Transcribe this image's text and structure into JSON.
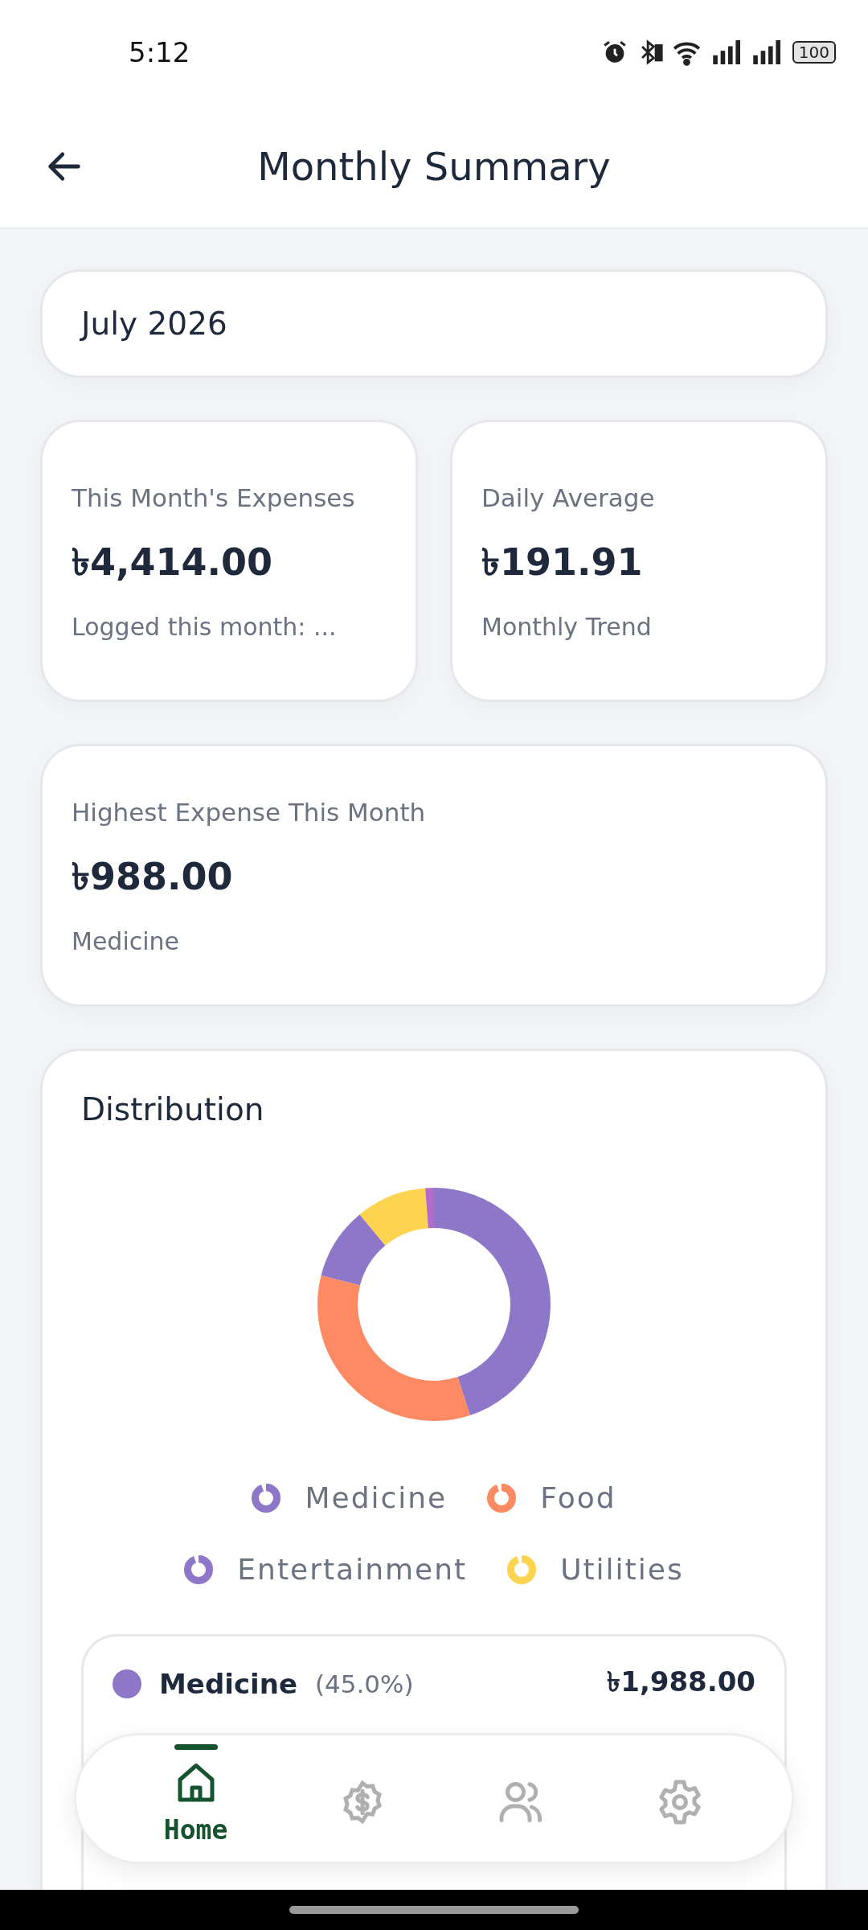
{
  "status_bar": {
    "time": "5:12",
    "battery": "100"
  },
  "header": {
    "title": "Monthly Summary"
  },
  "month": {
    "value": "July 2026"
  },
  "stats": [
    {
      "label": "This Month's Expenses",
      "value": "৳4,414.00",
      "note": "Logged this month: ..."
    },
    {
      "label": "Daily Average",
      "value": "৳191.91",
      "note": "Monthly Trend"
    }
  ],
  "highest": {
    "label": "Highest Expense This Month",
    "value": "৳988.00",
    "note": "Medicine"
  },
  "distribution": {
    "title": "Distribution",
    "legend": [
      {
        "label": "Medicine",
        "color": "#8e77c8"
      },
      {
        "label": "Food",
        "color": "#fd8a62"
      },
      {
        "label": "Entertainment",
        "color": "#8e77c8"
      },
      {
        "label": "Utilities",
        "color": "#fdd450"
      }
    ],
    "rows": [
      {
        "name": "Medicine",
        "percent": "(45.0%)",
        "amount": "৳1,988.00",
        "color": "#8e77c8"
      }
    ]
  },
  "nav": [
    {
      "kind": "home",
      "label": "Home",
      "selected": true
    },
    {
      "kind": "money",
      "selected": false
    },
    {
      "kind": "people",
      "selected": false
    },
    {
      "kind": "settings",
      "selected": false
    }
  ]
}
